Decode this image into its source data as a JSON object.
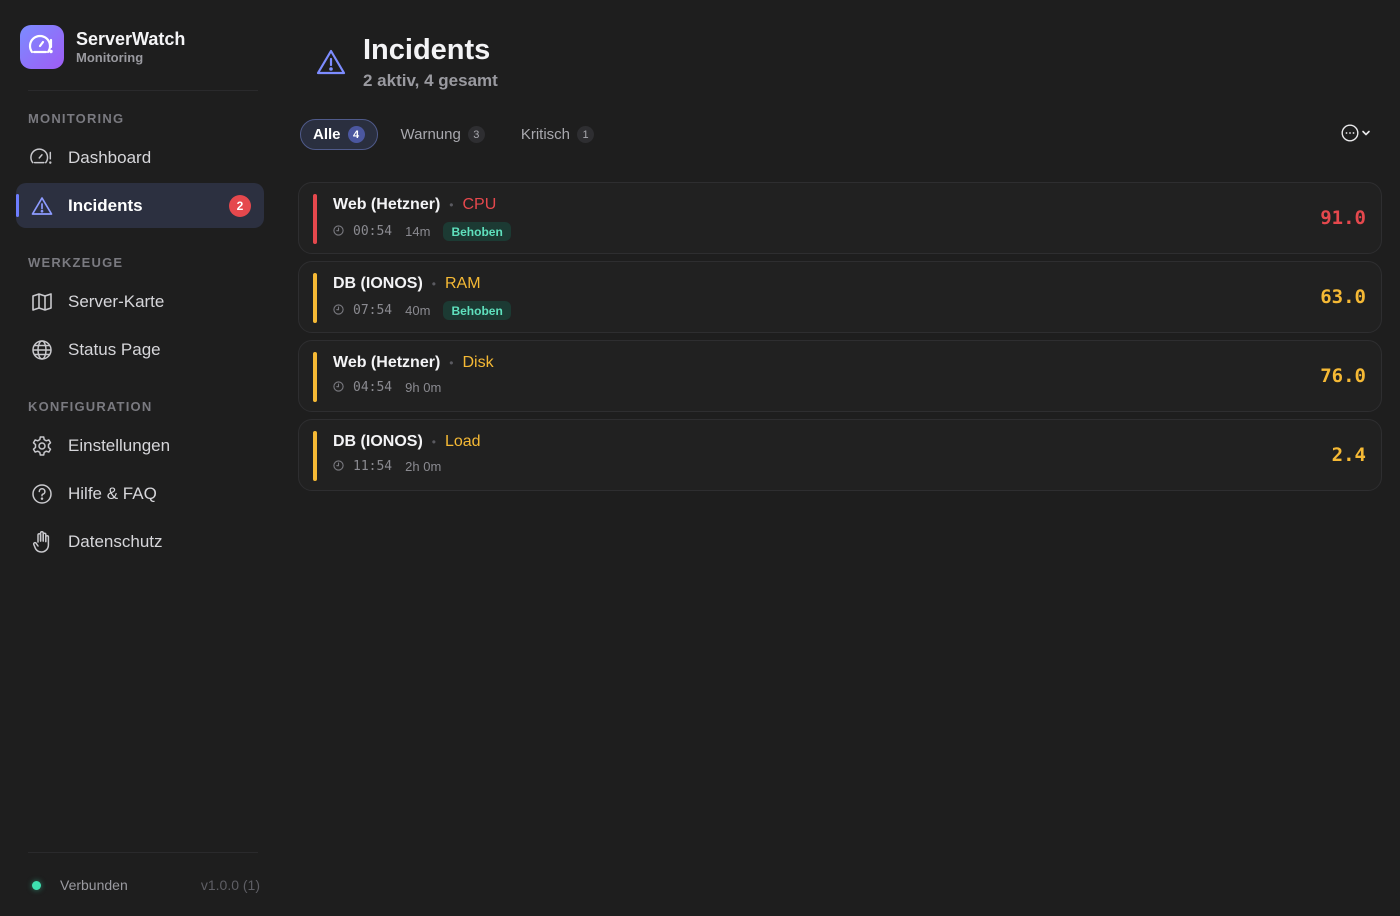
{
  "app": {
    "title": "ServerWatch",
    "subtitle": "Monitoring"
  },
  "sidebar": {
    "sections": [
      {
        "label": "MONITORING"
      },
      {
        "label": "WERKZEUGE"
      },
      {
        "label": "KONFIGURATION"
      }
    ],
    "items": [
      {
        "label": "Dashboard",
        "icon": "gauge-icon"
      },
      {
        "label": "Incidents",
        "icon": "warning-triangle-icon",
        "badge": "2",
        "active": true
      },
      {
        "label": "Server-Karte",
        "icon": "map-icon"
      },
      {
        "label": "Status Page",
        "icon": "globe-icon"
      },
      {
        "label": "Einstellungen",
        "icon": "gear-icon"
      },
      {
        "label": "Hilfe & FAQ",
        "icon": "question-circle-icon"
      },
      {
        "label": "Datenschutz",
        "icon": "hand-icon"
      }
    ],
    "footer": {
      "status": "Verbunden",
      "version": "v1.0.0 (1)"
    }
  },
  "header": {
    "title": "Incidents",
    "subtitle": "2 aktiv, 4 gesamt"
  },
  "tabs": [
    {
      "label": "Alle",
      "count": "4",
      "active": true
    },
    {
      "label": "Warnung",
      "count": "3"
    },
    {
      "label": "Kritisch",
      "count": "1"
    }
  ],
  "incidents": [
    {
      "server": "Web (Hetzner)",
      "metric": "CPU",
      "time": "00:54",
      "duration": "14m",
      "badge": "Behoben",
      "value": "91.0",
      "severity": "critical",
      "color": "#e5484d"
    },
    {
      "server": "DB (IONOS)",
      "metric": "RAM",
      "time": "07:54",
      "duration": "40m",
      "badge": "Behoben",
      "value": "63.0",
      "severity": "warning",
      "color": "#f5b935"
    },
    {
      "server": "Web (Hetzner)",
      "metric": "Disk",
      "time": "04:54",
      "duration": "9h 0m",
      "badge": "",
      "value": "76.0",
      "severity": "warning",
      "color": "#f5b935"
    },
    {
      "server": "DB (IONOS)",
      "metric": "Load",
      "time": "11:54",
      "duration": "2h 0m",
      "badge": "",
      "value": "2.4",
      "severity": "warning",
      "color": "#f5b935"
    }
  ],
  "colors": {
    "accent": "#6d7dff",
    "critical": "#e5484d",
    "warning": "#f5b935",
    "resolved": "#5fe0bd",
    "connected": "#3ee0b0"
  }
}
